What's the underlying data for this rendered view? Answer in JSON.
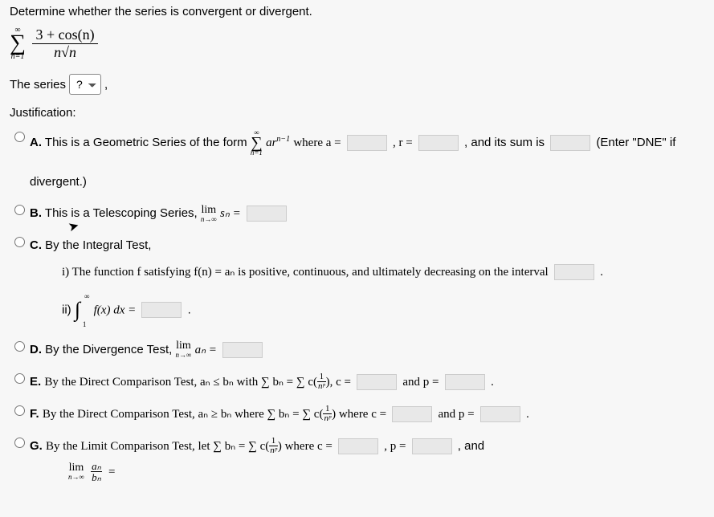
{
  "prompt": "Determine whether the series is convergent or divergent.",
  "series": {
    "sum_top": "∞",
    "sum_bottom": "n=1",
    "numerator": "3 + cos(n)",
    "denominator_left": "n",
    "denominator_radicand": "n"
  },
  "the_series_label": "The series",
  "dropdown_value": "?",
  "comma": ",",
  "justification_label": "Justification:",
  "options": {
    "A": {
      "letter": "A.",
      "pre": "This is a Geometric Series of the form",
      "sum_top": "∞",
      "sum_bottom": "n=1",
      "term": "ar",
      "term_exp": "n−1",
      "where_a": "where a =",
      "r_eq": ", r =",
      "sum_is": ", and its sum is",
      "tail": "(Enter \"DNE\" if",
      "line2": "divergent.)"
    },
    "B": {
      "letter": "B.",
      "pre": "This is a Telescoping Series,",
      "lim": "lim",
      "limsub": "n→∞",
      "sn": "sₙ ="
    },
    "C": {
      "letter": "C.",
      "pre": "By the Integral Test,",
      "i_pre": "i) The function f satisfying f(n) = aₙ is positive, continuous, and ultimately decreasing on the interval",
      "i_period": ".",
      "ii_label": "ii)",
      "int_lb": "1",
      "int_ub": "∞",
      "ii_expr": "f(x) dx =",
      "ii_period": "."
    },
    "D": {
      "letter": "D.",
      "pre": "By the Divergence Test,",
      "lim": "lim",
      "limsub": "n→∞",
      "an": "aₙ ="
    },
    "E": {
      "letter": "E.",
      "pre": "By the Direct Comparison Test, aₙ ≤ bₙ with ∑ bₙ = ∑ c(",
      "frac_n": "1",
      "frac_d": "nᵖ",
      "after_paren": "), c =",
      "and_p": "and p =",
      "period": "."
    },
    "F": {
      "letter": "F.",
      "pre": "By the Direct Comparison Test, aₙ ≥ bₙ where ∑ bₙ = ∑ c(",
      "frac_n": "1",
      "frac_d": "nᵖ",
      "after_paren": ") where c =",
      "and_p": "and p =",
      "period": "."
    },
    "G": {
      "letter": "G.",
      "pre": "By the Limit Comparison Test, let ∑ bₙ = ∑ c(",
      "frac_n": "1",
      "frac_d": "nᵖ",
      "after_paren": ") where c =",
      "p_eq": ", p =",
      "and": ", and",
      "lim": "lim",
      "limsub": "n→∞",
      "frac2_n": "aₙ",
      "frac2_d": "bₙ",
      "eq": "="
    }
  }
}
